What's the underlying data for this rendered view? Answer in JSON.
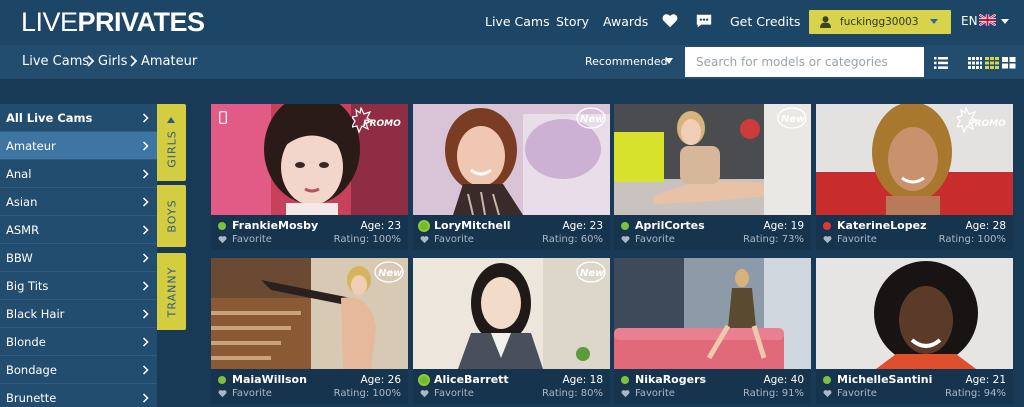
{
  "header": {
    "logo_part1": "LIVE",
    "logo_part2": "PRIVATES",
    "nav": [
      "Live Cams",
      "Story",
      "Awards"
    ],
    "favorites_icon": "heart-icon",
    "messages_icon": "chat-icon",
    "get_credits": "Get Credits",
    "username": "fuckingg30003",
    "language": "EN"
  },
  "breadcrumb": [
    "Live Cams",
    "Girls",
    "Amateur"
  ],
  "toolbar": {
    "sort_label": "Recommended",
    "search_placeholder": "Search for models or categories"
  },
  "sidebar": {
    "categories": [
      "All Live Cams",
      "Amateur",
      "Anal",
      "Asian",
      "ASMR",
      "BBW",
      "Big Tits",
      "Black Hair",
      "Blonde",
      "Bondage",
      "Brunette"
    ],
    "active_index": 1
  },
  "gender_tabs": [
    "GIRLS",
    "BOYS",
    "TRANNY"
  ],
  "models": [
    {
      "name": "FrankieMosby",
      "age": "Age: 23",
      "rating": "Rating: 100%",
      "favorite": "Favorite",
      "badge": "PROMO",
      "status_color": "#7ec13f"
    },
    {
      "name": "LoryMitchell",
      "age": "Age: 23",
      "rating": "Rating: 60%",
      "favorite": "Favorite",
      "badge": "New",
      "status_color": "#7ec13f"
    },
    {
      "name": "AprilCortes",
      "age": "Age: 19",
      "rating": "Rating: 73%",
      "favorite": "Favorite",
      "badge": "New",
      "status_color": "#7ec13f"
    },
    {
      "name": "KaterineLopez",
      "age": "Age: 28",
      "rating": "Rating: 100%",
      "favorite": "Favorite",
      "badge": "PROMO",
      "status_color": "#e03a2e"
    },
    {
      "name": "MaiaWillson",
      "age": "Age: 26",
      "rating": "Rating: 100%",
      "favorite": "Favorite",
      "badge": "New",
      "status_color": "#7ec13f"
    },
    {
      "name": "AliceBarrett",
      "age": "Age: 18",
      "rating": "Rating: 80%",
      "favorite": "Favorite",
      "badge": "New",
      "status_color": "#7ec13f"
    },
    {
      "name": "NikaRogers",
      "age": "Age: 40",
      "rating": "Rating: 91%",
      "favorite": "Favorite",
      "badge": "",
      "status_color": "#7ec13f"
    },
    {
      "name": "MichelleSantini",
      "age": "Age: 21",
      "rating": "Rating: 94%",
      "favorite": "Favorite",
      "badge": "",
      "status_color": "#7ec13f"
    }
  ],
  "colors": {
    "accent_yellow": "#d8d34a",
    "online_green": "#7ec13f",
    "busy_red": "#e03a2e"
  }
}
